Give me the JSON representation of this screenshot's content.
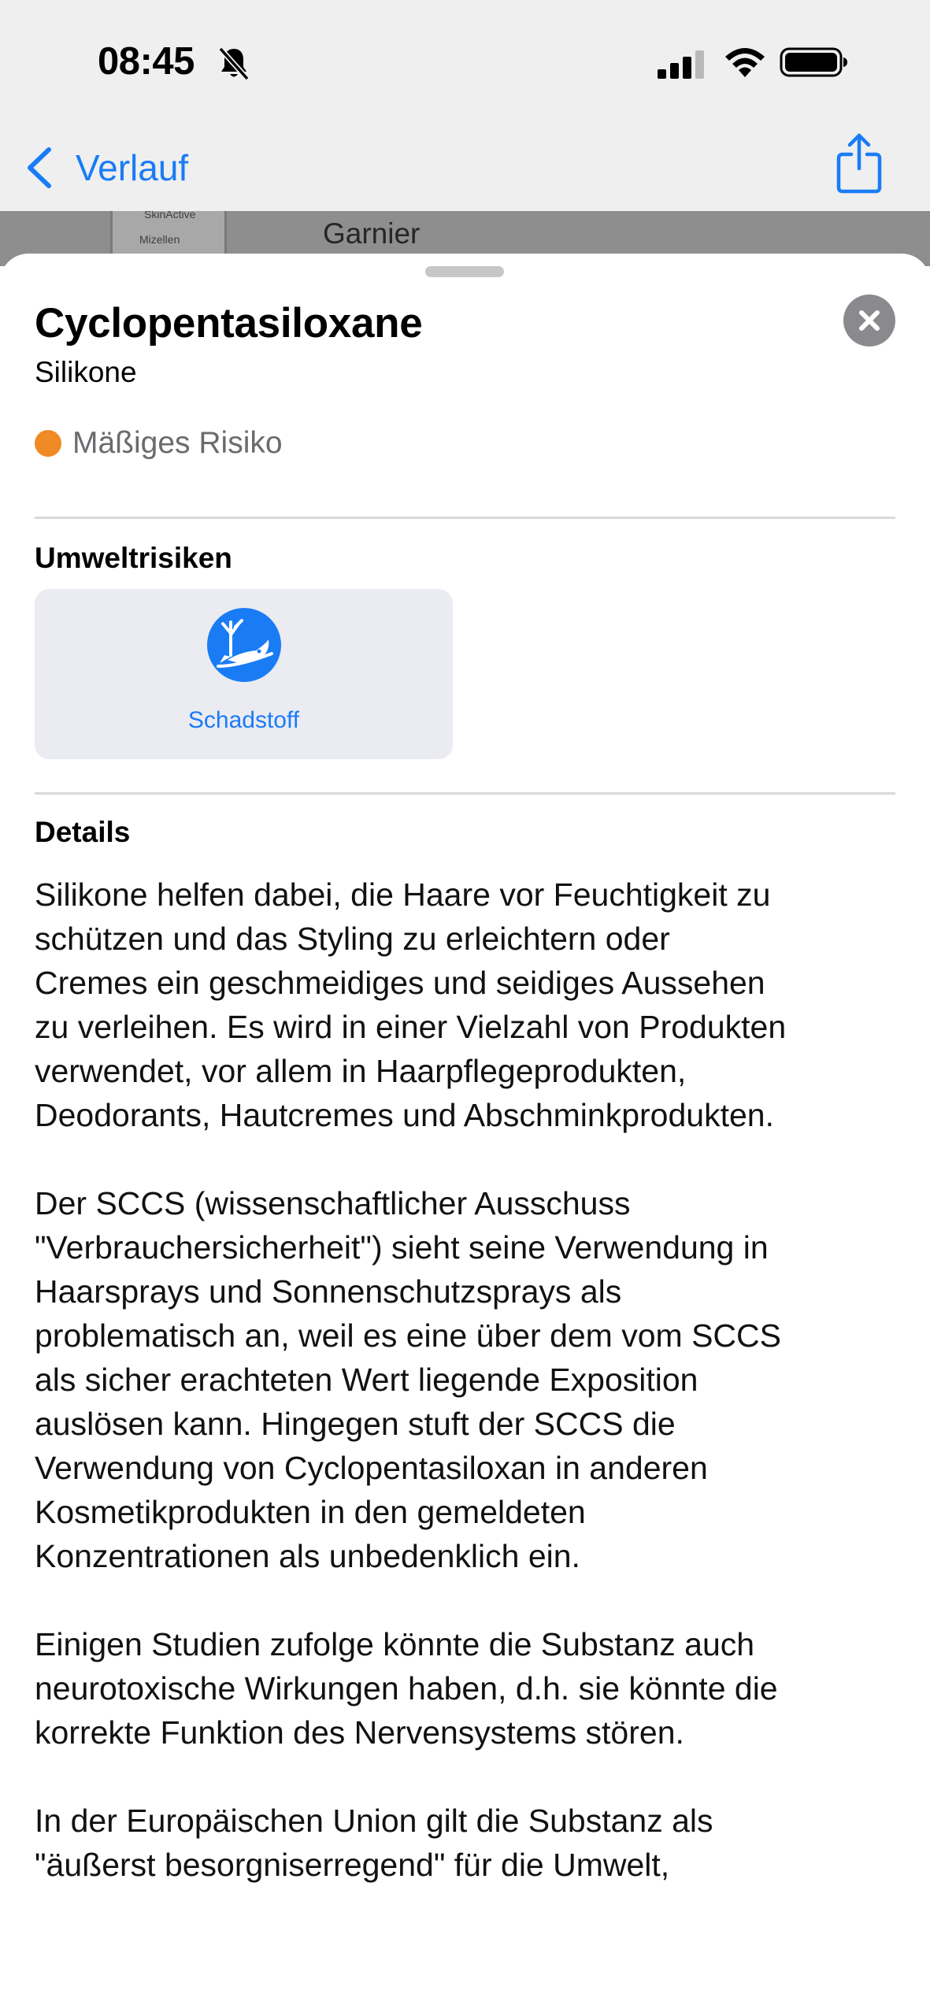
{
  "status_bar": {
    "time": "08:45",
    "icons": [
      "bell-slash-icon",
      "cellular-signal-icon",
      "wifi-icon",
      "battery-icon"
    ]
  },
  "nav": {
    "back_label": "Verlauf",
    "share_icon": "share-icon"
  },
  "background_list": {
    "thumb_text_1": "SkinActive",
    "thumb_text_2": "Mizellen",
    "brand": "Garnier"
  },
  "sheet": {
    "title": "Cyclopentasiloxane",
    "category": "Silikone",
    "risk": {
      "label": "Mäßiges Risiko",
      "color": "#f08a24"
    },
    "environment": {
      "heading": "Umweltrisiken",
      "items": [
        {
          "label": "Schadstoff",
          "icon": "pollutant-fish-icon",
          "color": "#1a7cf5"
        }
      ]
    },
    "details": {
      "heading": "Details",
      "paragraphs": [
        "Silikone helfen dabei, die Haare vor Feuchtigkeit zu\nschützen und das Styling zu erleichtern oder\nCremes ein geschmeidiges und seidiges Aussehen\nzu verleihen. Es wird in einer Vielzahl von Produkten\nverwendet, vor allem in Haarpflegeprodukten,\nDeodorants, Hautcremes und Abschminkprodukten.",
        "Der SCCS (wissenschaftlicher Ausschuss\n\"Verbrauchersicherheit\") sieht seine Verwendung in\nHaarsprays und Sonnenschutzsprays als\nproblematisch an, weil es eine über dem vom SCCS\nals sicher erachteten Wert liegende Exposition\nauslösen kann. Hingegen stuft der SCCS die\nVerwendung von Cyclopentasiloxan in anderen\nKosmetikprodukten in den gemeldeten\nKonzentrationen als unbedenklich ein.",
        "Einigen Studien zufolge könnte die Substanz auch\nneurotoxische Wirkungen haben, d.h. sie könnte die\nkorrekte Funktion des Nervensystems stören.",
        "In der Europäischen Union gilt die Substanz als\n\"äußerst besorgniserregend\" für die Umwelt,"
      ]
    }
  },
  "colors": {
    "accent": "#1a7cf5",
    "risk_orange": "#f08a24",
    "close_gray": "#8a8a8e"
  }
}
